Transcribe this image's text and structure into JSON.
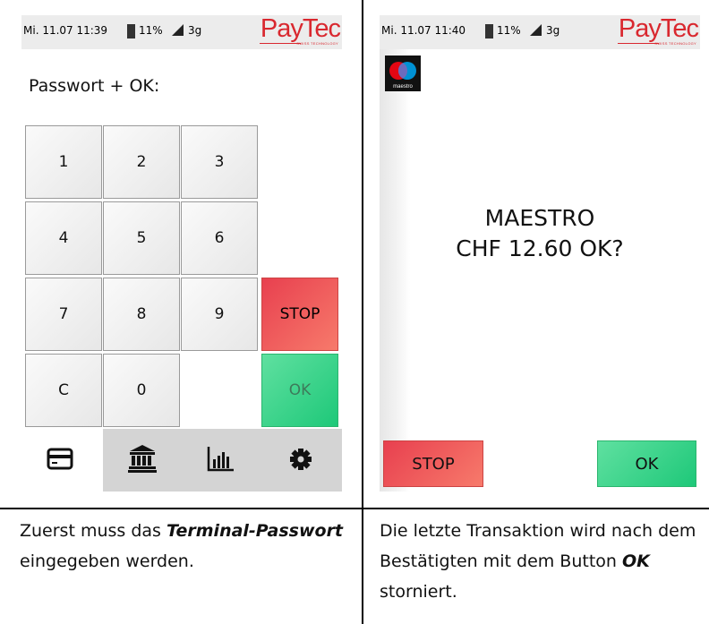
{
  "left_screen": {
    "status": {
      "datetime": "Mi. 11.07 11:39",
      "battery": "11%",
      "network": "3g"
    },
    "logo": {
      "name": "PayTec",
      "tagline": "SWISS TECHNOLOGY"
    },
    "prompt": "Passwort + OK:",
    "keypad": {
      "k1": "1",
      "k2": "2",
      "k3": "3",
      "k4": "4",
      "k5": "5",
      "k6": "6",
      "k7": "7",
      "k8": "8",
      "k9": "9",
      "stop": "STOP",
      "clear": "C",
      "k0": "0",
      "ok": "OK"
    },
    "nav": [
      {
        "icon": "credit-card-icon",
        "active": true
      },
      {
        "icon": "bank-icon",
        "active": false
      },
      {
        "icon": "bar-chart-icon",
        "active": false
      },
      {
        "icon": "gear-icon",
        "active": false
      }
    ]
  },
  "right_screen": {
    "status": {
      "datetime": "Mi. 11.07 11:40",
      "battery": "11%",
      "network": "3g"
    },
    "logo": {
      "name": "PayTec",
      "tagline": "SWISS TECHNOLOGY"
    },
    "card_logo": {
      "name": "maestro"
    },
    "confirm_line1": "MAESTRO",
    "confirm_line2": "CHF 12.60 OK?",
    "stop_label": "STOP",
    "ok_label": "OK"
  },
  "captions": {
    "left": {
      "part1": "Zuerst muss das ",
      "bold": "Terminal-Passwort",
      "part2": " eingegeben werden."
    },
    "right": {
      "part1": "Die letzte Transaktion wird nach dem Bestätigten mit dem Button ",
      "bold": "OK",
      "part2": " storniert."
    }
  },
  "colors": {
    "stop": "#ea4655",
    "ok": "#2fd088",
    "brand": "#d9282f",
    "statusbar": "#ececec",
    "navbar": "#d4d4d4"
  }
}
